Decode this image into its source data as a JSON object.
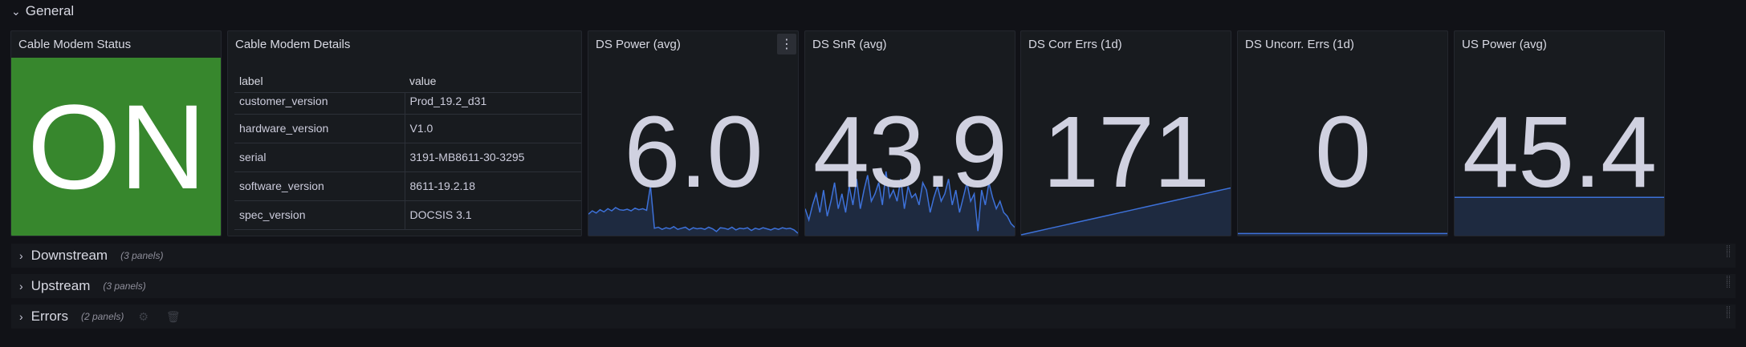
{
  "rows": {
    "general": {
      "label": "General"
    },
    "downstream": {
      "label": "Downstream",
      "count": "(3 panels)"
    },
    "upstream": {
      "label": "Upstream",
      "count": "(3 panels)"
    },
    "errors": {
      "label": "Errors",
      "count": "(2 panels)"
    }
  },
  "panels": {
    "status": {
      "title": "Cable Modem Status",
      "value": "ON",
      "color": "#37872d"
    },
    "details": {
      "title": "Cable Modem Details",
      "headers": {
        "label": "label",
        "value": "value"
      },
      "rows": [
        {
          "label": "customer_version",
          "value": "Prod_19.2_d31"
        },
        {
          "label": "hardware_version",
          "value": "V1.0"
        },
        {
          "label": "serial",
          "value": "3191-MB8611-30-3295"
        },
        {
          "label": "software_version",
          "value": "8611-19.2.18"
        },
        {
          "label": "spec_version",
          "value": "DOCSIS 3.1"
        }
      ]
    },
    "ds_power": {
      "title": "DS Power (avg)",
      "value": "6.0",
      "menu_icon": "kebab-icon",
      "sparkline": [
        0.38,
        0.44,
        0.4,
        0.46,
        0.42,
        0.48,
        0.44,
        0.5,
        0.46,
        0.45,
        0.47,
        0.44,
        0.49,
        0.46,
        0.48,
        0.45,
        0.9,
        0.12,
        0.14,
        0.1,
        0.13,
        0.11,
        0.15,
        0.1,
        0.12,
        0.14,
        0.09,
        0.13,
        0.11,
        0.12,
        0.1,
        0.14,
        0.11,
        0.06,
        0.13,
        0.12,
        0.1,
        0.14,
        0.09,
        0.12,
        0.11,
        0.13,
        0.08,
        0.12,
        0.1,
        0.13,
        0.11,
        0.09,
        0.12,
        0.1,
        0.13,
        0.11,
        0.12,
        0.09,
        0.03
      ]
    },
    "ds_snr": {
      "title": "DS SnR (avg)",
      "value": "43.9",
      "sparkline": [
        0.35,
        0.2,
        0.4,
        0.55,
        0.3,
        0.6,
        0.25,
        0.45,
        0.7,
        0.35,
        0.55,
        0.3,
        0.65,
        0.4,
        0.75,
        0.35,
        0.6,
        0.8,
        0.45,
        0.55,
        0.7,
        0.4,
        0.85,
        0.5,
        0.6,
        0.45,
        0.75,
        0.35,
        0.65,
        0.5,
        0.55,
        0.4,
        0.7,
        0.6,
        0.3,
        0.5,
        0.65,
        0.45,
        0.55,
        0.75,
        0.4,
        0.6,
        0.3,
        0.5,
        0.7,
        0.45,
        0.55,
        0.05,
        0.6,
        0.4,
        0.7,
        0.5,
        0.35,
        0.45,
        0.3,
        0.25,
        0.15,
        0.1
      ]
    },
    "ds_corr": {
      "title": "DS Corr Errs (1d)",
      "value": "171",
      "sparkline": [
        0.0,
        0.05,
        0.1,
        0.15,
        0.2,
        0.25,
        0.3,
        0.35,
        0.4,
        0.45,
        0.5,
        0.55,
        0.6,
        0.65,
        0.7,
        0.75
      ]
    },
    "ds_uncorr": {
      "title": "DS Uncorr. Errs (1d)",
      "value": "0",
      "sparkline": [
        0.02,
        0.02,
        0.02,
        0.02
      ]
    },
    "us_power": {
      "title": "US Power (avg)",
      "value": "45.4",
      "sparkline": [
        0.6,
        0.6,
        0.6,
        0.6
      ]
    }
  },
  "colors": {
    "line": "#3d71d9",
    "fill": "rgba(61,113,217,0.18)",
    "status_bg": "#37872d"
  }
}
